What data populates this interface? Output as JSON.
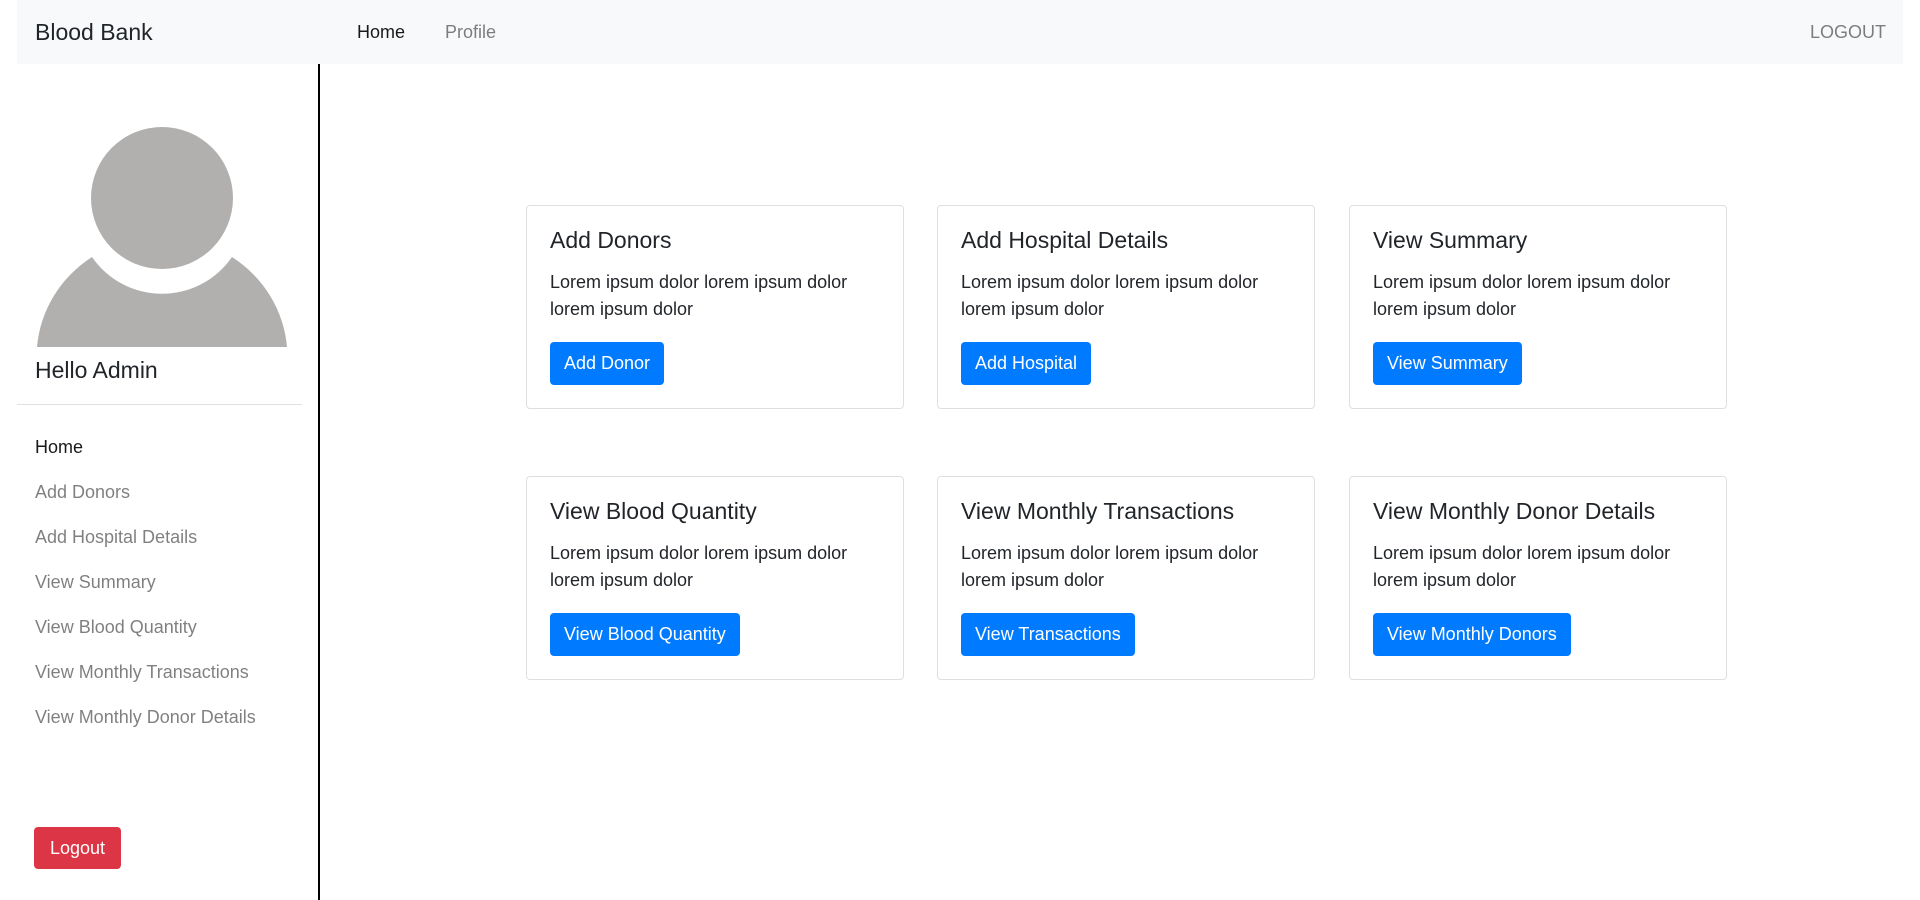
{
  "navbar": {
    "brand": "Blood Bank",
    "links": [
      {
        "label": "Home",
        "active": true
      },
      {
        "label": "Profile",
        "active": false
      }
    ],
    "logout_label": "LOGOUT"
  },
  "sidebar": {
    "avatar_icon": "user-avatar-icon",
    "greeting": "Hello Admin",
    "items": [
      {
        "label": "Home",
        "active": true
      },
      {
        "label": "Add Donors",
        "active": false
      },
      {
        "label": "Add Hospital Details",
        "active": false
      },
      {
        "label": "View Summary",
        "active": false
      },
      {
        "label": "View Blood Quantity",
        "active": false
      },
      {
        "label": "View Monthly Transactions",
        "active": false
      },
      {
        "label": "View Monthly Donor Details",
        "active": false
      }
    ],
    "logout_label": "Logout"
  },
  "cards": [
    {
      "title": "Add Donors",
      "text": "Lorem ipsum dolor lorem ipsum dolor lorem ipsum dolor",
      "button": "Add Donor"
    },
    {
      "title": "Add Hospital Details",
      "text": "Lorem ipsum dolor lorem ipsum dolor lorem ipsum dolor",
      "button": "Add Hospital"
    },
    {
      "title": "View Summary",
      "text": "Lorem ipsum dolor lorem ipsum dolor lorem ipsum dolor",
      "button": "View Summary"
    },
    {
      "title": "View Blood Quantity",
      "text": "Lorem ipsum dolor lorem ipsum dolor lorem ipsum dolor",
      "button": "View Blood Quantity"
    },
    {
      "title": "View Monthly Transactions",
      "text": "Lorem ipsum dolor lorem ipsum dolor lorem ipsum dolor",
      "button": "View Transactions"
    },
    {
      "title": "View Monthly Donor Details",
      "text": "Lorem ipsum dolor lorem ipsum dolor lorem ipsum dolor",
      "button": "View Monthly Donors"
    }
  ],
  "colors": {
    "primary": "#007bff",
    "danger": "#dc3545",
    "navbar_bg": "#f8f9fa",
    "avatar": "#b1b0af"
  }
}
